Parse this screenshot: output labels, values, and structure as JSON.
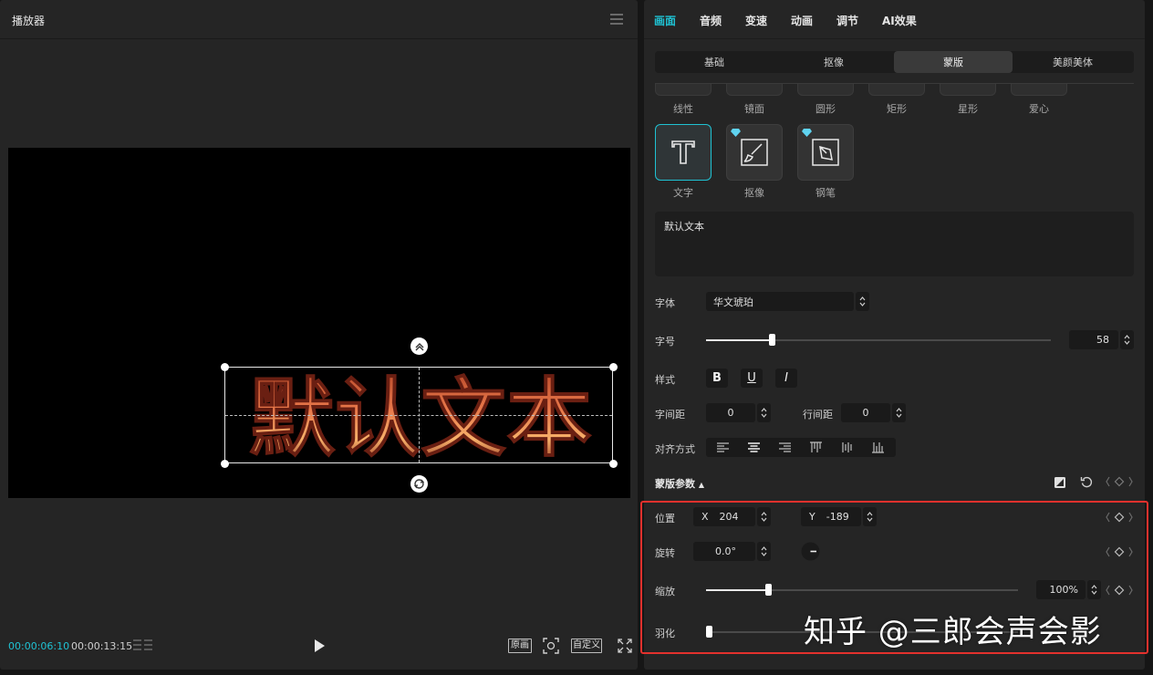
{
  "player": {
    "title": "播放器",
    "current_time": "00:00:06:10",
    "total_time": "00:00:13:15",
    "btn_original": "原画",
    "btn_custom": "自定义",
    "preview_text": "默认文本"
  },
  "tabs": [
    "画面",
    "音频",
    "变速",
    "动画",
    "调节",
    "AI效果"
  ],
  "subtabs": [
    "基础",
    "抠像",
    "蒙版",
    "美颜美体"
  ],
  "shape_labels": [
    "线性",
    "镜面",
    "圆形",
    "矩形",
    "星形",
    "爱心"
  ],
  "mask_cards": [
    "文字",
    "抠像",
    "钢笔"
  ],
  "text_content": "默认文本",
  "font": {
    "label": "字体",
    "value": "华文琥珀"
  },
  "size": {
    "label": "字号",
    "value": "58",
    "level": 0.19
  },
  "style": {
    "label": "样式",
    "bold": "B",
    "underline": "U",
    "italic": "I"
  },
  "spacing": {
    "char_label": "字间距",
    "char_value": "0",
    "line_label": "行间距",
    "line_value": "0"
  },
  "align": {
    "label": "对齐方式"
  },
  "mask_params": {
    "title": "蒙版参数",
    "position_label": "位置",
    "x_label": "X",
    "x_value": "204",
    "y_label": "Y",
    "y_value": "-189",
    "rotate_label": "旋转",
    "rotate_value": "0.0°",
    "scale_label": "缩放",
    "scale_value": "100%",
    "scale_level": 0.2,
    "feather_label": "羽化",
    "feather_level": 0.0
  },
  "watermark": "知乎 @三郎会声会影",
  "colors": {
    "accent": "#1fc2d3",
    "highlight_box": "#e3312d",
    "panel": "#252525"
  }
}
